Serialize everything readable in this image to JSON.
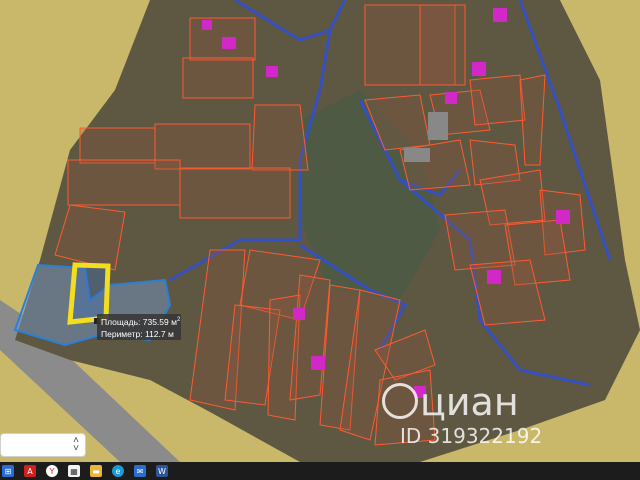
{
  "measurement": {
    "area_label": "Площадь:",
    "area_value": "735.59 м",
    "area_superscript": "2",
    "perimeter_label": "Периметр:",
    "perimeter_value": "112.7 м"
  },
  "watermark": {
    "brand": "циан",
    "listing_id": "ID 319322192"
  },
  "url_field": {
    "icon": "chevron-updown-icon"
  },
  "taskbar": {
    "icons": [
      "start-icon",
      "acrobat-icon",
      "yandex-browser-icon",
      "calendar-icon",
      "file-explorer-icon",
      "edge-icon",
      "mail-icon",
      "word-icon"
    ]
  },
  "colors": {
    "background_land": "#c9b86a",
    "imagery": "#5e5742",
    "parcel_outline": "#ff5a30",
    "boundary_blue": "#2f4fd6",
    "selected_parcel": "#2a7fd9",
    "highlight_yellow": "#f2dd1f",
    "marker_magenta": "#d228c8",
    "road": "#8b8b8b"
  }
}
